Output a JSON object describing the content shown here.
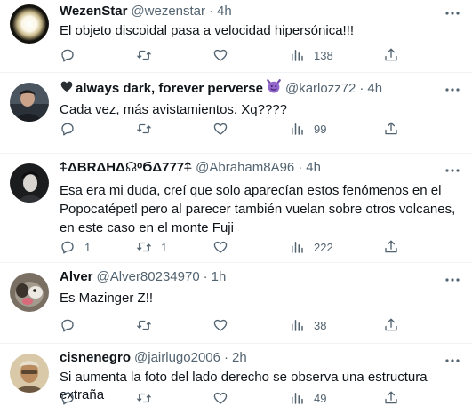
{
  "tweets": [
    {
      "name": "WezenStar",
      "handle": "@wezenstar",
      "time": "4h",
      "text": "El objeto discoidal pasa a velocidad hipersónica!!!",
      "replies": "",
      "retweets": "",
      "likes": "",
      "views": "138"
    },
    {
      "name": "always dark, forever perverse",
      "name_prefix_icon": "black-heart-icon",
      "name_suffix_icon": "purple-devil-emoji-icon",
      "handle": "@karlozz72",
      "time": "4h",
      "text": "Cada vez, más avistamientos. Xq????",
      "replies": "",
      "retweets": "",
      "likes": "",
      "views": "99"
    },
    {
      "name": "⍏ΔBRΔHΔ☊ᵒϬΔ777⍏",
      "handle": "@Abraham8A96",
      "time": "4h",
      "text": "Esa era mi duda, creí que solo aparecían estos fenómenos en el Popocatépetl pero al parecer también vuelan sobre otros volcanes, en este caso en el monte Fuji",
      "replies": "1",
      "retweets": "1",
      "likes": "",
      "views": "222"
    },
    {
      "name": "Alver",
      "handle": "@Alver80234970",
      "time": "1h",
      "text": "Es Mazinger Z!!",
      "replies": "",
      "retweets": "",
      "likes": "",
      "views": "38"
    },
    {
      "name": "cisnenegro",
      "handle": "@jairlugo2006",
      "time": "2h",
      "text": "Si aumenta la foto del lado derecho se observa una estructura extraña",
      "replies": "",
      "retweets": "",
      "likes": "",
      "views": "49"
    }
  ],
  "ui": {
    "separator": "·",
    "text_color": "#0f1419",
    "muted_color": "#536471",
    "divider_color": "#eff3f4"
  }
}
